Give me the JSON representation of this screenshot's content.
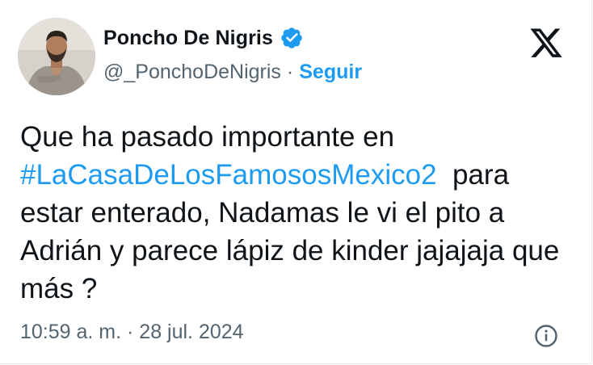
{
  "author": {
    "name": "Poncho De Nigris",
    "handle": "@_PonchoDeNigris",
    "separator": "·",
    "follow_label": "Seguir"
  },
  "tweet": {
    "text_before": "Que ha pasado importante en",
    "hashtag": "#LaCasaDeLosFamososMexico2",
    "text_after": "para estar enterado, Nadamas le vi el pito a Adrián y parece lápiz de kinder jajajaja que más ?"
  },
  "meta": {
    "timestamp": "10:59 a. m. · 28 jul. 2024"
  },
  "icons": {
    "verified": "verified-badge-icon",
    "logo": "x-logo-icon",
    "info": "info-icon"
  },
  "colors": {
    "accent": "#1d9bf0",
    "text": "#0f1419",
    "muted": "#536471"
  }
}
